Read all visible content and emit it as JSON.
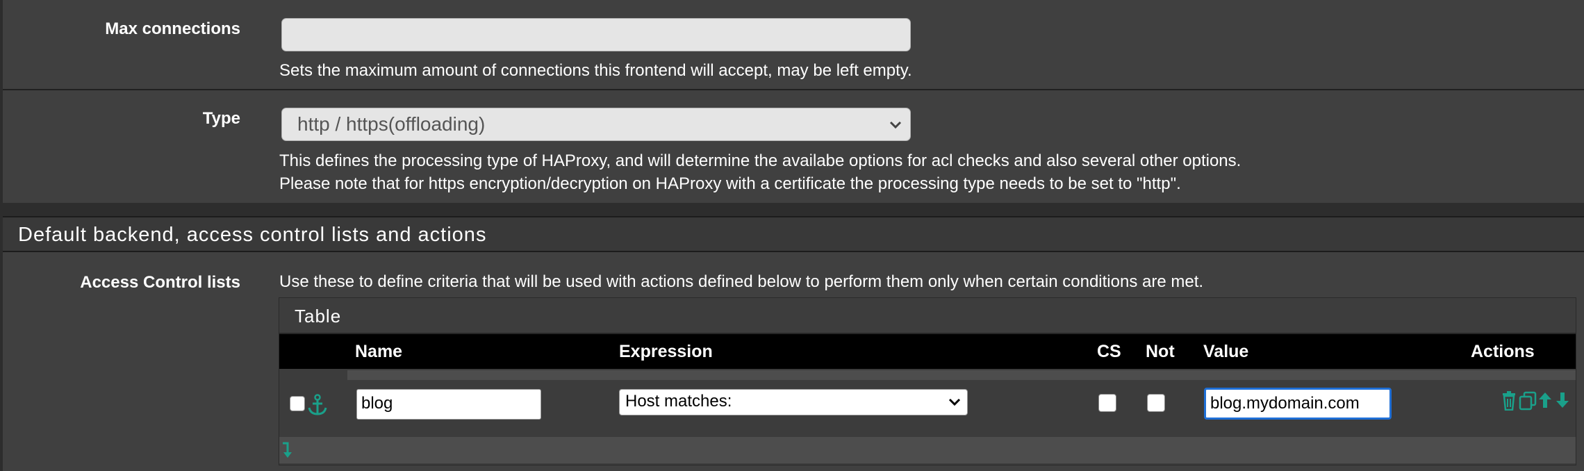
{
  "max_connections": {
    "label": "Max connections",
    "value": "",
    "help": "Sets the maximum amount of connections this frontend will accept, may be left empty."
  },
  "type": {
    "label": "Type",
    "selected": "http / https(offloading)",
    "help_line1": "This defines the processing type of HAProxy, and will determine the availabe options for acl checks and also several other options.",
    "help_line2": "Please note that for https encryption/decryption on HAProxy with a certificate the processing type needs to be set to \"http\"."
  },
  "section": {
    "title": "Default backend, access control lists and actions"
  },
  "acl": {
    "label": "Access Control lists",
    "help": "Use these to define criteria that will be used with actions defined below to perform them only when certain conditions are met.",
    "table_title": "Table",
    "columns": {
      "name": "Name",
      "expression": "Expression",
      "cs": "CS",
      "not": "Not",
      "value": "Value",
      "actions": "Actions"
    },
    "rows": [
      {
        "name": "blog",
        "expression": "Host matches:",
        "cs": false,
        "not": false,
        "value": "blog.mydomain.com"
      }
    ]
  },
  "colors": {
    "accent": "#1aa08a",
    "focus": "#1f6fd6",
    "row_bg": "#404040",
    "header_bg": "#000000"
  },
  "icons": [
    "anchor-icon",
    "delete-icon",
    "copy-icon",
    "move-up-icon",
    "move-down-icon",
    "insert-row-icon",
    "chevron-down-icon"
  ]
}
